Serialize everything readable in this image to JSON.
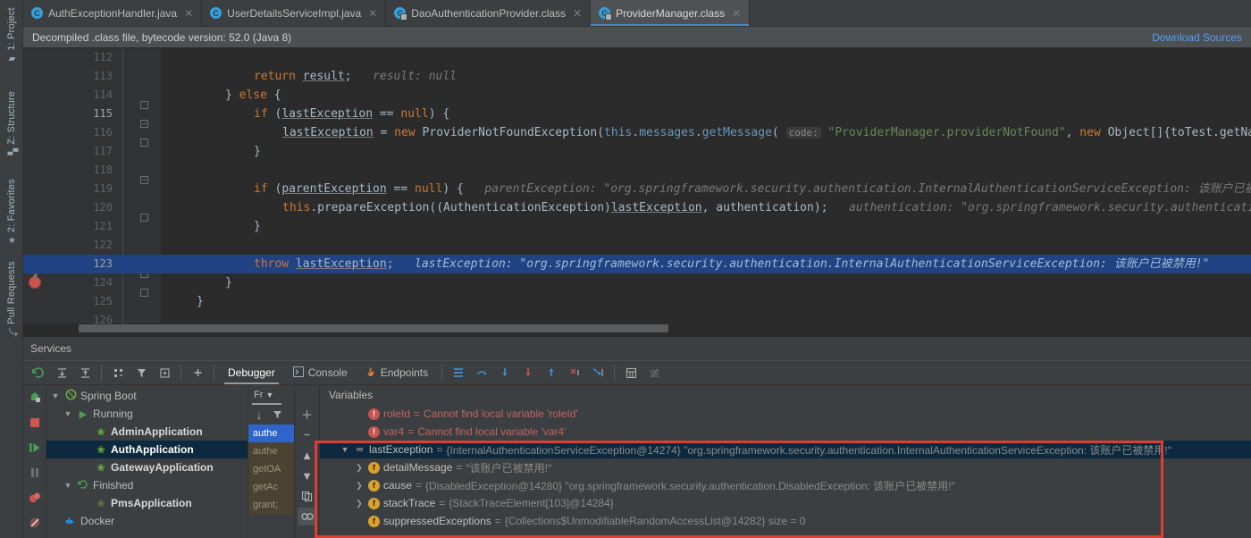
{
  "left_tool_strip": [
    {
      "label": "1: Project",
      "icon": "folder-icon"
    },
    {
      "label": "Z: Structure",
      "icon": "structure-icon"
    },
    {
      "label": "2: Favorites",
      "icon": "star-icon"
    },
    {
      "label": "Pull Requests",
      "icon": "pull-request-icon"
    }
  ],
  "editor_tabs": [
    {
      "label": "AuthExceptionHandler.java",
      "icon": "java-class-icon",
      "active": false
    },
    {
      "label": "UserDetailsServiceImpl.java",
      "icon": "java-class-icon",
      "active": false
    },
    {
      "label": "DaoAuthenticationProvider.class",
      "icon": "compiled-class-icon",
      "active": false
    },
    {
      "label": "ProviderManager.class",
      "icon": "compiled-class-icon",
      "active": true
    }
  ],
  "notice": {
    "text": "Decompiled .class file, bytecode version: 52.0 (Java 8)",
    "link": "Download Sources"
  },
  "editor": {
    "lines": [
      {
        "num": "112",
        "code": "",
        "hint": ""
      },
      {
        "num": "113",
        "code": "return result;",
        "hint": "result: null"
      },
      {
        "num": "114",
        "code": "} else {",
        "hint": ""
      },
      {
        "num": "115",
        "code": "if (lastException == null) {",
        "hint": ""
      },
      {
        "num": "116",
        "code": "lastException = new ProviderNotFoundException(this.messages.getMessage( code: \"ProviderManager.providerNotFound\", new Object[]{toTest.getName()}, d",
        "hint": ""
      },
      {
        "num": "117",
        "code": "}",
        "hint": ""
      },
      {
        "num": "118",
        "code": "",
        "hint": ""
      },
      {
        "num": "119",
        "code": "if (parentException == null) {",
        "hint": "parentException: \"org.springframework.security.authentication.InternalAuthenticationServiceException: 该账户已被禁用!\""
      },
      {
        "num": "120",
        "code": "this.prepareException((AuthenticationException)lastException, authentication);",
        "hint": "authentication: \"org.springframework.security.authentication.Usern"
      },
      {
        "num": "121",
        "code": "}",
        "hint": ""
      },
      {
        "num": "122",
        "code": "",
        "hint": ""
      },
      {
        "num": "123",
        "code": "throw lastException;",
        "hint": "lastException: \"org.springframework.security.authentication.InternalAuthenticationServiceException: 该账户已被禁用!\""
      },
      {
        "num": "124",
        "code": "}",
        "hint": ""
      },
      {
        "num": "125",
        "code": "}",
        "hint": ""
      },
      {
        "num": "126",
        "code": "",
        "hint": ""
      }
    ],
    "param_hint_code": "code:",
    "breakpoint_line": "123"
  },
  "services": {
    "title": "Services",
    "toolbar_icons": [
      "rerun-icon",
      "expand-all-icon",
      "collapse-all-icon",
      "group-by-icon",
      "filter-icon",
      "add-tab-icon",
      "add-service-icon"
    ],
    "debug_tabs": [
      {
        "label": "Debugger",
        "icon": "debugger-icon",
        "active": true
      },
      {
        "label": "Console",
        "icon": "console-icon",
        "active": false
      },
      {
        "label": "Endpoints",
        "icon": "endpoints-icon",
        "active": false
      }
    ],
    "step_icons": [
      "layout-icon",
      "step-over-icon",
      "step-into-icon",
      "force-step-into-icon",
      "step-out-icon",
      "drop-frame-icon",
      "run-to-cursor-icon",
      "evaluate-expression-icon",
      "mute-breakpoints-icon"
    ],
    "run_strip_icons": [
      "rerun-app-icon",
      "stop-icon",
      "resume-icon",
      "pause-icon",
      "view-breakpoints-icon",
      "mute-breakpoints-icon"
    ],
    "tree": [
      {
        "label": "Spring Boot",
        "icon": "spring-boot-icon",
        "indent": 0,
        "arrow": "v",
        "bold": false,
        "selected": false
      },
      {
        "label": "Running",
        "icon": "running-icon",
        "indent": 1,
        "arrow": "v",
        "bold": false,
        "selected": false
      },
      {
        "label": "AdminApplication",
        "icon": "spring-app-icon",
        "indent": 2,
        "arrow": "",
        "bold": true,
        "selected": false
      },
      {
        "label": "AuthApplication",
        "icon": "spring-app-icon",
        "indent": 2,
        "arrow": "",
        "bold": true,
        "selected": true
      },
      {
        "label": "GatewayApplication",
        "icon": "spring-app-icon",
        "indent": 2,
        "arrow": "",
        "bold": true,
        "selected": false
      },
      {
        "label": "Finished",
        "icon": "finished-icon",
        "indent": 1,
        "arrow": "v",
        "bold": false,
        "selected": false
      },
      {
        "label": "PmsApplication",
        "icon": "spring-app-dim-icon",
        "indent": 2,
        "arrow": "",
        "bold": true,
        "selected": false
      },
      {
        "label": "Docker",
        "icon": "docker-icon",
        "indent": 0,
        "arrow": "",
        "bold": false,
        "selected": false
      }
    ],
    "frames": {
      "header": "Fr",
      "tools": [
        "sort-icon",
        "filter-icon"
      ],
      "rows": [
        {
          "label": "authe",
          "state": "selected"
        },
        {
          "label": "authe",
          "state": "dim"
        },
        {
          "label": "getOA",
          "state": "dim"
        },
        {
          "label": "getAc",
          "state": "dim"
        },
        {
          "label": "grant;",
          "state": "dim"
        }
      ]
    },
    "variables_buttons": [
      "add-icon",
      "remove-icon",
      "up-icon",
      "down-icon",
      "copy-icon",
      "watch-icon"
    ],
    "variables": {
      "header": "Variables",
      "rows": [
        {
          "expander": "",
          "icon": "error-icon",
          "name": "roleId",
          "sep": " = ",
          "value": "Cannot find local variable 'roleId'",
          "error": true,
          "selected": false
        },
        {
          "expander": "",
          "icon": "error-icon",
          "name": "var4",
          "sep": " = ",
          "value": "Cannot find local variable 'var4'",
          "error": true,
          "selected": false
        },
        {
          "expander": "v",
          "icon": "object-icon",
          "name": "lastException",
          "sep": " = ",
          "value": "{InternalAuthenticationServiceException@14274} \"org.springframework.security.authentication.InternalAuthenticationServiceException: 该账户已被禁用!\"",
          "error": false,
          "selected": true
        },
        {
          "expander": ">",
          "icon": "field-icon",
          "name": "detailMessage",
          "sep": " = ",
          "value": "\"该账户已被禁用!\"",
          "error": false,
          "selected": false
        },
        {
          "expander": ">",
          "icon": "field-icon",
          "name": "cause",
          "sep": " = ",
          "value": "{DisabledException@14280} \"org.springframework.security.authentication.DisabledException: 该账户已被禁用!\"",
          "error": false,
          "selected": false
        },
        {
          "expander": ">",
          "icon": "field-icon",
          "name": "stackTrace",
          "sep": " = ",
          "value": "{StackTraceElement[103]@14284}",
          "error": false,
          "selected": false
        },
        {
          "expander": "",
          "icon": "field-icon",
          "name": "suppressedExceptions",
          "sep": " = ",
          "value": "{Collections$UnmodifiableRandomAccessList@14282}  size = 0",
          "error": false,
          "selected": false
        }
      ]
    }
  },
  "colors": {
    "accent": "#4a88c7",
    "selection": "#214283",
    "error": "#c75450",
    "highlight_box": "#e03c32",
    "editor_bg": "#2b2b2b",
    "panel_bg": "#3c3f41",
    "keyword": "#cc7832",
    "string": "#6a8759",
    "field": "#9876aa"
  }
}
